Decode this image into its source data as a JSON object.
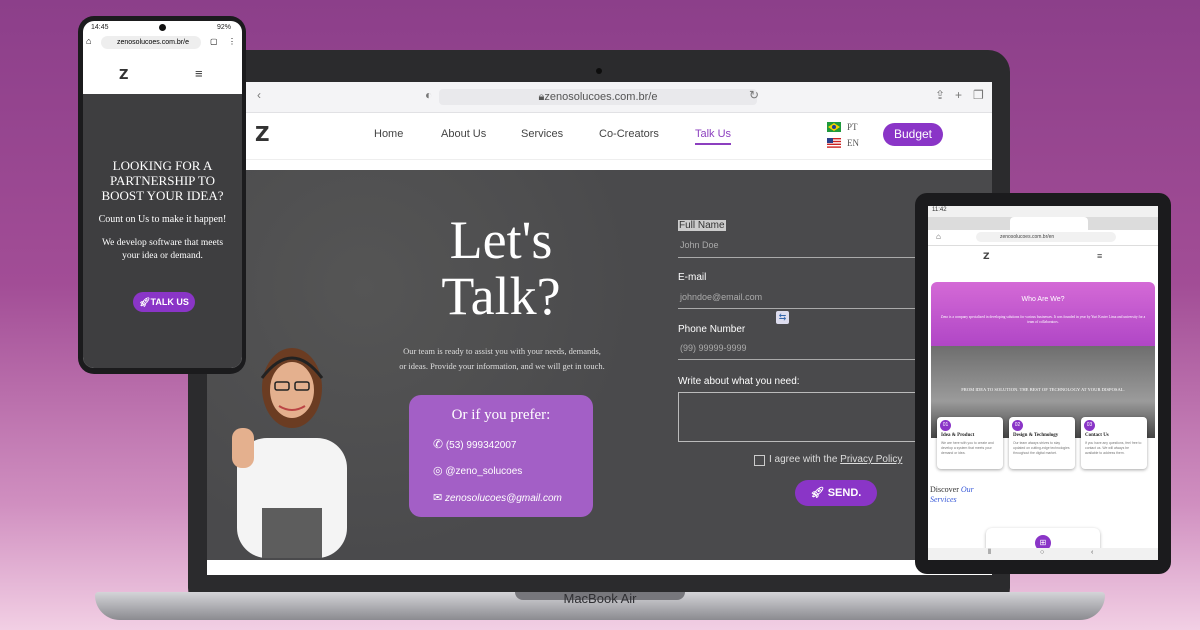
{
  "laptop": {
    "label": "MacBook Air",
    "browser": {
      "url": "zenosolucoes.com.br/e"
    },
    "nav": {
      "logo": "Z",
      "items": [
        "Home",
        "About Us",
        "Services",
        "Co-Creators",
        "Talk Us"
      ],
      "active_item": "Talk Us",
      "languages": [
        "PT",
        "EN"
      ],
      "budget_button": "Budget"
    },
    "hero": {
      "heading_line1": "Let's",
      "heading_line2": "Talk?",
      "lead_line1": "Our team is ready to assist you with your needs, demands,",
      "lead_line2": "or ideas. Provide your information, and we will get in touch.",
      "prefer": {
        "title": "Or if you prefer:",
        "phone": "(53) 999342007",
        "instagram": "@zeno_solucoes",
        "email": "zenosolucoes@gmail.com"
      }
    },
    "form": {
      "full_name_label": "Full Name",
      "full_name_placeholder": "John Doe",
      "email_label": "E-mail",
      "email_placeholder": "johndoe@email.com",
      "phone_label": "Phone Number",
      "phone_placeholder": "(99) 99999-9999",
      "message_label": "Write about what you need:",
      "agree_text": "I agree with the",
      "privacy_link": "Privacy Policy",
      "send_button": "SEND."
    }
  },
  "phone": {
    "status_time": "14:45",
    "battery": "92%",
    "url": "zenosolucoes.com.br/e",
    "logo": "Z",
    "heading": "LOOKING FOR A PARTNERSHIP TO BOOST YOUR IDEA?",
    "tagline": "Count on Us to make it happen!",
    "body": "We develop software that meets your idea or demand.",
    "talk_button": "TALK US"
  },
  "tablet": {
    "status_time": "11:42",
    "url": "zenosolucoes.com.br/en",
    "logo": "Z",
    "who_title": "Who Are We?",
    "who_text": "Zeno is a company specialized in developing solutions for various businesses. It was founded in year by Yuri Koster Lima and university for a team of collaborators.",
    "banner": "FROM IDEA TO SOLUTION. THE BEST OF TECHNOLOGY AT YOUR DISPOSAL.",
    "cards": [
      {
        "num": "01",
        "title": "Idea & Product",
        "text": "We are here with you to create and develop a system that meets your demand or idea."
      },
      {
        "num": "02",
        "title": "Design & Technology",
        "text": "Our team always strives to stay updated on cutting-edge technologies throughout the digital market."
      },
      {
        "num": "03",
        "title": "Contact Us",
        "text": "If you have any questions, feel free to contact us. We will always be available to address them."
      }
    ],
    "discover_prefix": "Discover",
    "discover_link_1": "Our",
    "discover_link_2": "Services"
  },
  "colors": {
    "accent": "#8a35c7",
    "background": "#9a4a94",
    "hero_dark": "#4a4a4c"
  }
}
